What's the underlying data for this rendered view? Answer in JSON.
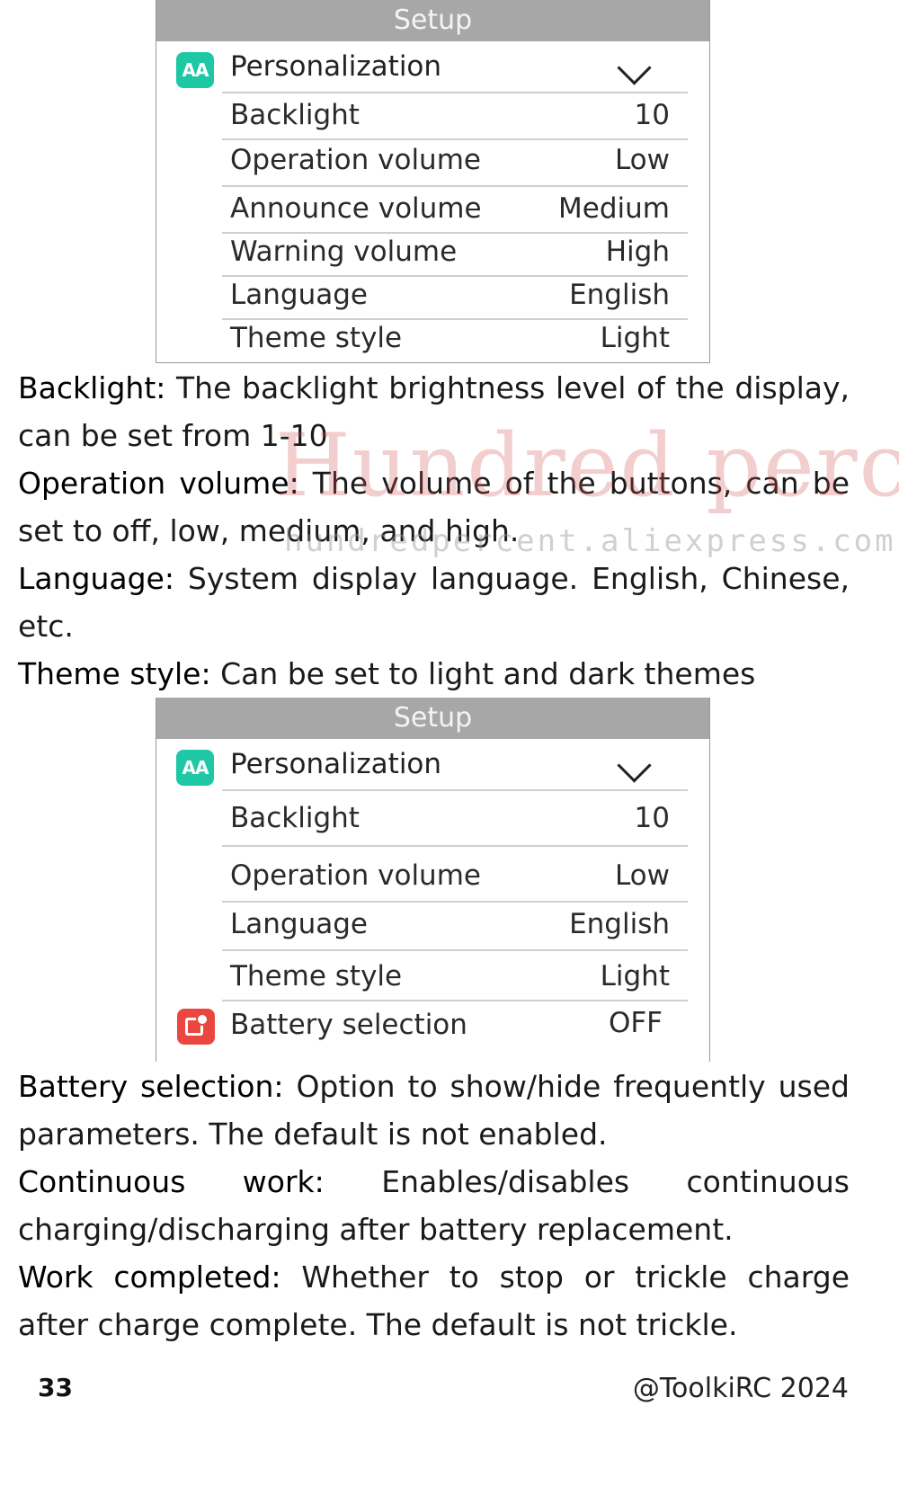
{
  "screen1": {
    "title": "Setup",
    "group": {
      "icon": "text-size-icon",
      "icon_text": "AA",
      "label": "Personalization",
      "chevron": "chevron-down-icon"
    },
    "rows": [
      {
        "label": "Backlight",
        "value": "10"
      },
      {
        "label": "Operation volume",
        "value": "Low"
      },
      {
        "label": "Announce volume",
        "value": "Medium"
      },
      {
        "label": "Warning volume",
        "value": "High"
      },
      {
        "label": "Language",
        "value": "English"
      },
      {
        "label": "Theme style",
        "value": "Light"
      }
    ]
  },
  "section1": {
    "backlight_term": "Backlight:",
    "backlight_text": " The backlight brightness level of the display, can be set from 1-10",
    "opvol_term": "Operation volume:",
    "opvol_text": " The volume of the buttons, can be set to off, low, medium, and high.",
    "language_term": "Language:",
    "language_text": " System display language. English, Chinese, etc.",
    "theme_term": "Theme style:",
    "theme_text": " Can be set to light and dark themes"
  },
  "watermark": {
    "big": "Hundred percent",
    "small": "hundredpercent.aliexpress.com"
  },
  "screen2": {
    "title": "Setup",
    "group": {
      "icon": "text-size-icon",
      "icon_text": "AA",
      "label": "Personalization",
      "chevron": "chevron-down-icon"
    },
    "rows": [
      {
        "label": "Backlight",
        "value": "10"
      },
      {
        "label": "Operation volume",
        "value": "Low"
      },
      {
        "label": "Language",
        "value": "English"
      },
      {
        "label": "Theme style",
        "value": "Light"
      },
      {
        "label": "Battery selection",
        "value": "OFF",
        "icon": "battery-selection-icon"
      }
    ]
  },
  "section2": {
    "battsel_term": "Battery selection:",
    "battsel_text": " Option to show/hide frequently used parameters. The default is not enabled.",
    "cont_term": "Continuous work:",
    "cont_text": " Enables/disables continuous charging/discharging after battery replacement.",
    "done_term": "Work completed:",
    "done_text": " Whether to stop or trickle charge after charge complete. The default is not trickle."
  },
  "footer": {
    "page": "33",
    "credit": "@ToolkiRC 2024"
  },
  "colors": {
    "titlebar": "#a7a7a7",
    "personalization_icon": "#1ec8a5",
    "battery_icon": "#e9473f"
  }
}
